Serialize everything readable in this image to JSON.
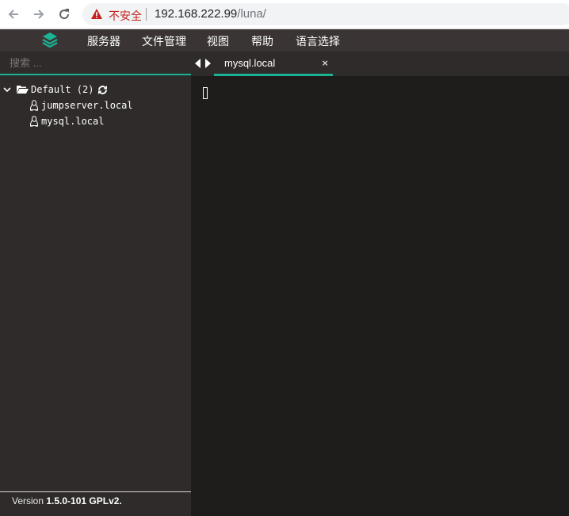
{
  "browser": {
    "security_label": "不安全",
    "url_host": "192.168.222.99",
    "url_path": "/luna/"
  },
  "menubar": {
    "items": [
      "服务器",
      "文件管理",
      "视图",
      "帮助",
      "语言选择"
    ]
  },
  "sidebar": {
    "search_placeholder": "搜索 ...",
    "group": {
      "label": "Default (2)"
    },
    "hosts": [
      {
        "label": "jumpserver.local",
        "icon": "linux-icon"
      },
      {
        "label": "mysql.local",
        "icon": "linux-icon"
      }
    ],
    "footer": {
      "prefix": "Version ",
      "version": "1.5.0-101 GPLv2."
    }
  },
  "tabs": [
    {
      "title": "mysql.local",
      "close": "×"
    }
  ],
  "colors": {
    "accent": "#1ab394",
    "menubar": "#3a3534",
    "sidebar": "#2f2b2a",
    "terminal": "#1f1d1c"
  }
}
